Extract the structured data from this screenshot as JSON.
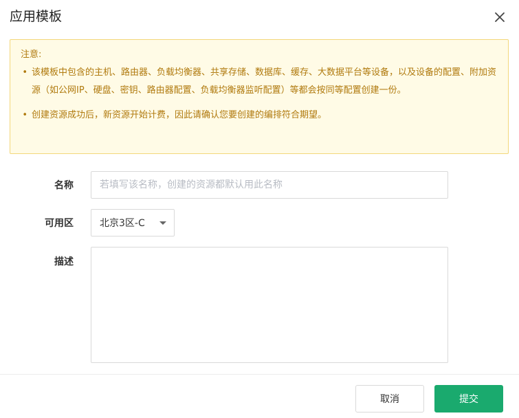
{
  "dialog": {
    "title": "应用模板",
    "close_icon": "close-icon"
  },
  "notice": {
    "title": "注意:",
    "items": [
      "该模板中包含的主机、路由器、负载均衡器、共享存储、数据库、缓存、大数据平台等设备，以及设备的配置、附加资源（如公网IP、硬盘、密钥、路由器配置、负载均衡器监听配置）等都会按同等配置创建一份。",
      "创建资源成功后，新资源开始计费，因此请确认您要创建的编排符合期望。"
    ],
    "bullet": "•",
    "colors": {
      "background": "#fffbe6",
      "border": "#f3d77a",
      "text": "#b07a0e"
    }
  },
  "form": {
    "name": {
      "label": "名称",
      "value": "",
      "placeholder": "若填写该名称，创建的资源都默认用此名称"
    },
    "zone": {
      "label": "可用区",
      "selected": "北京3区-C"
    },
    "description": {
      "label": "描述",
      "value": ""
    }
  },
  "footer": {
    "cancel_label": "取消",
    "submit_label": "提交",
    "colors": {
      "submit": "#1aaa6e"
    }
  }
}
